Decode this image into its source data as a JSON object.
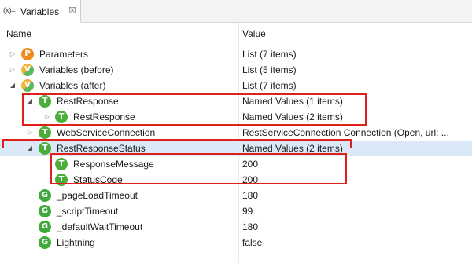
{
  "tab": {
    "icon_text": "(x)=",
    "title": "Variables",
    "close_glyph": "☒"
  },
  "columns": {
    "name": "Name",
    "value": "Value"
  },
  "rows": [
    {
      "name": "Parameters",
      "value": "List (7 items)",
      "icon": "P",
      "icon_kind": "parameters-icon"
    },
    {
      "name": "Variables (before)",
      "value": "List (5 items)",
      "icon": "V",
      "icon_kind": "variables-before-icon"
    },
    {
      "name": "Variables (after)",
      "value": "List (7 items)",
      "icon": "V",
      "icon_kind": "variables-after-icon"
    },
    {
      "name": "RestResponse",
      "value": "Named Values (1 items)",
      "icon": "T"
    },
    {
      "name": "RestResponse",
      "value": "Named Values (2 items)",
      "icon": "T"
    },
    {
      "name": "WebServiceConnection",
      "value": "RestServiceConnection Connection (Open, url: ...",
      "icon": "T"
    },
    {
      "name": "RestResponseStatus",
      "value": "Named Values (2 items)",
      "icon": "T"
    },
    {
      "name": "ResponseMessage",
      "value": "200",
      "icon": "T"
    },
    {
      "name": "StatusCode",
      "value": "200",
      "icon": "T"
    },
    {
      "name": "_pageLoadTimeout",
      "value": "180",
      "icon": "G"
    },
    {
      "name": "_scriptTimeout",
      "value": "99",
      "icon": "G"
    },
    {
      "name": "_defaultWaitTimeout",
      "value": "180",
      "icon": "G"
    },
    {
      "name": "Lightning",
      "value": "false",
      "icon": "G"
    }
  ],
  "tree_state": {
    "expanded_rows": [
      "Variables (after)",
      "RestResponse",
      "RestResponseStatus"
    ],
    "selected_row": "RestResponseStatus"
  },
  "colors": {
    "highlight_box": "#e0201b",
    "selection": "#dbe8f7",
    "green_icon": "#3fa93b",
    "orange_icon": "#f08c1d"
  }
}
